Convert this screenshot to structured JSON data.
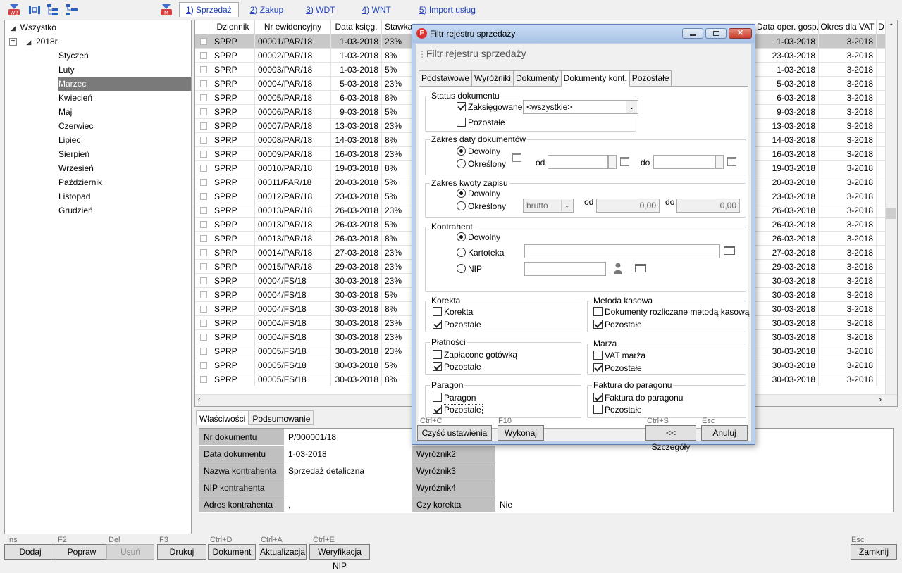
{
  "toolbar": {
    "icons": [
      "w2-icon",
      "columns-icon",
      "tree-expand-icon",
      "tree-collapse-icon",
      "m-icon"
    ],
    "tabs": [
      {
        "key": "1",
        "label": "Sprzedaż"
      },
      {
        "key": "2",
        "label": "Zakup"
      },
      {
        "key": "3",
        "label": "WDT"
      },
      {
        "key": "4",
        "label": "WNT"
      },
      {
        "key": "5",
        "label": "Import usług"
      }
    ]
  },
  "tree": {
    "root": "Wszystko",
    "year": "2018r.",
    "months": [
      "Styczeń",
      "Luty",
      "Marzec",
      "Kwiecień",
      "Maj",
      "Czerwiec",
      "Lipiec",
      "Sierpień",
      "Wrzesień",
      "Październik",
      "Listopad",
      "Grudzień"
    ],
    "selected_month": "Marzec"
  },
  "grid": {
    "columns": [
      "Dziennik",
      "Nr ewidencyjny",
      "Data księg.",
      "Stawka",
      "Data oper. gosp.",
      "Okres dla VAT",
      "D"
    ],
    "rows": [
      [
        "SPRP",
        "00001/PAR/18",
        "1-03-2018",
        "23%",
        "1-03-2018",
        "3-2018"
      ],
      [
        "SPRP",
        "00002/PAR/18",
        "1-03-2018",
        "8%",
        "23-03-2018",
        "3-2018"
      ],
      [
        "SPRP",
        "00003/PAR/18",
        "1-03-2018",
        "5%",
        "1-03-2018",
        "3-2018"
      ],
      [
        "SPRP",
        "00004/PAR/18",
        "5-03-2018",
        "23%",
        "5-03-2018",
        "3-2018"
      ],
      [
        "SPRP",
        "00005/PAR/18",
        "6-03-2018",
        "8%",
        "6-03-2018",
        "3-2018"
      ],
      [
        "SPRP",
        "00006/PAR/18",
        "9-03-2018",
        "5%",
        "9-03-2018",
        "3-2018"
      ],
      [
        "SPRP",
        "00007/PAR/18",
        "13-03-2018",
        "23%",
        "13-03-2018",
        "3-2018"
      ],
      [
        "SPRP",
        "00008/PAR/18",
        "14-03-2018",
        "8%",
        "14-03-2018",
        "3-2018"
      ],
      [
        "SPRP",
        "00009/PAR/18",
        "16-03-2018",
        "23%",
        "16-03-2018",
        "3-2018"
      ],
      [
        "SPRP",
        "00010/PAR/18",
        "19-03-2018",
        "8%",
        "19-03-2018",
        "3-2018"
      ],
      [
        "SPRP",
        "00011/PAR/18",
        "20-03-2018",
        "5%",
        "20-03-2018",
        "3-2018"
      ],
      [
        "SPRP",
        "00012/PAR/18",
        "23-03-2018",
        "5%",
        "23-03-2018",
        "3-2018"
      ],
      [
        "SPRP",
        "00013/PAR/18",
        "26-03-2018",
        "23%",
        "26-03-2018",
        "3-2018"
      ],
      [
        "SPRP",
        "00013/PAR/18",
        "26-03-2018",
        "5%",
        "26-03-2018",
        "3-2018"
      ],
      [
        "SPRP",
        "00013/PAR/18",
        "26-03-2018",
        "8%",
        "26-03-2018",
        "3-2018"
      ],
      [
        "SPRP",
        "00014/PAR/18",
        "27-03-2018",
        "23%",
        "27-03-2018",
        "3-2018"
      ],
      [
        "SPRP",
        "00015/PAR/18",
        "29-03-2018",
        "23%",
        "29-03-2018",
        "3-2018"
      ],
      [
        "SPRP",
        "00004/FS/18",
        "30-03-2018",
        "23%",
        "30-03-2018",
        "3-2018"
      ],
      [
        "SPRP",
        "00004/FS/18",
        "30-03-2018",
        "5%",
        "30-03-2018",
        "3-2018"
      ],
      [
        "SPRP",
        "00004/FS/18",
        "30-03-2018",
        "8%",
        "30-03-2018",
        "3-2018"
      ],
      [
        "SPRP",
        "00004/FS/18",
        "30-03-2018",
        "23%",
        "30-03-2018",
        "3-2018"
      ],
      [
        "SPRP",
        "00004/FS/18",
        "30-03-2018",
        "23%",
        "30-03-2018",
        "3-2018"
      ],
      [
        "SPRP",
        "00005/FS/18",
        "30-03-2018",
        "23%",
        "30-03-2018",
        "3-2018"
      ],
      [
        "SPRP",
        "00005/FS/18",
        "30-03-2018",
        "5%",
        "30-03-2018",
        "3-2018"
      ],
      [
        "SPRP",
        "00005/FS/18",
        "30-03-2018",
        "8%",
        "30-03-2018",
        "3-2018"
      ]
    ]
  },
  "props": {
    "tabs": [
      "Właściwości",
      "Podsumowanie"
    ],
    "rows": [
      {
        "l1": "Nr dokumentu",
        "v1": "P/000001/18",
        "l2": "",
        "v2": ""
      },
      {
        "l1": "Data dokumentu",
        "v1": "1-03-2018",
        "l2": "Wyróżnik2",
        "v2": ""
      },
      {
        "l1": "Nazwa kontrahenta",
        "v1": "Sprzedaż detaliczna",
        "l2": "Wyróżnik3",
        "v2": ""
      },
      {
        "l1": "NIP kontrahenta",
        "v1": "",
        "l2": "Wyróżnik4",
        "v2": ""
      },
      {
        "l1": "Adres kontrahenta",
        "v1": ",",
        "l2": "Czy korekta",
        "v2": "Nie"
      }
    ]
  },
  "bottom": {
    "buttons": [
      {
        "key": "Ins",
        "label": "Dodaj",
        "enabled": true
      },
      {
        "key": "F2",
        "label": "Popraw",
        "enabled": true
      },
      {
        "key": "Del",
        "label": "Usuń",
        "enabled": false
      },
      {
        "key": "F3",
        "label": "Drukuj",
        "enabled": true
      },
      {
        "key": "Ctrl+D",
        "label": "Dokument",
        "enabled": true
      },
      {
        "key": "Ctrl+A",
        "label": "Aktualizacja",
        "enabled": true
      },
      {
        "key": "Ctrl+E",
        "label": "Weryfikacja NIP",
        "enabled": true
      }
    ],
    "close": {
      "key": "Esc",
      "label": "Zamknij"
    }
  },
  "dialog": {
    "title": "Filtr rejestru sprzedaży",
    "header": "Filtr rejestru sprzedaży",
    "tabs": [
      "Podstawowe",
      "Wyróżniki",
      "Dokumenty",
      "Dokumenty kont.",
      "Pozostałe"
    ],
    "active_tab": "Dokumenty kont.",
    "status": {
      "legend": "Status dokumentu",
      "zaksiegowane": "Zaksięgowane",
      "zaksiegowane_checked": true,
      "select_value": "<wszystkie>",
      "pozostale": "Pozostałe",
      "pozostale_checked": false
    },
    "daty": {
      "legend": "Zakres daty dokumentów",
      "dowolny": "Dowolny",
      "okreslony": "Określony",
      "od": "od",
      "do": "do"
    },
    "kwoty": {
      "legend": "Zakres kwoty zapisu",
      "dowolny": "Dowolny",
      "okreslony": "Określony",
      "type": "brutto",
      "od": "od",
      "do": "do",
      "od_value": "0,00",
      "do_value": "0,00"
    },
    "kontrahent": {
      "legend": "Kontrahent",
      "dowolny": "Dowolny",
      "kartoteka": "Kartoteka",
      "nip": "NIP"
    },
    "korekta": {
      "legend": "Korekta",
      "a": "Korekta",
      "a_checked": false,
      "b": "Pozostałe",
      "b_checked": true
    },
    "metoda": {
      "legend": "Metoda kasowa",
      "a": "Dokumenty rozliczane metodą kasową",
      "a_checked": false,
      "b": "Pozostałe",
      "b_checked": true
    },
    "platnosci": {
      "legend": "Płatności",
      "a": "Zapłacone gotówką",
      "a_checked": false,
      "b": "Pozostałe",
      "b_checked": true
    },
    "marza": {
      "legend": "Marża",
      "a": "VAT marża",
      "a_checked": false,
      "b": "Pozostałe",
      "b_checked": true
    },
    "paragon": {
      "legend": "Paragon",
      "a": "Paragon",
      "a_checked": false,
      "b": "Pozostałe",
      "b_checked": true
    },
    "faktura": {
      "legend": "Faktura do paragonu",
      "a": "Faktura do paragonu",
      "a_checked": true,
      "b": "Pozostałe",
      "b_checked": false
    },
    "buttons": {
      "clear_key": "Ctrl+C",
      "clear": "Czyść ustawienia",
      "run_key": "F10",
      "run": "Wykonaj",
      "details_key": "Ctrl+S",
      "details": "<< Szczegóły",
      "cancel_key": "Esc",
      "cancel": "Anuluj"
    }
  }
}
